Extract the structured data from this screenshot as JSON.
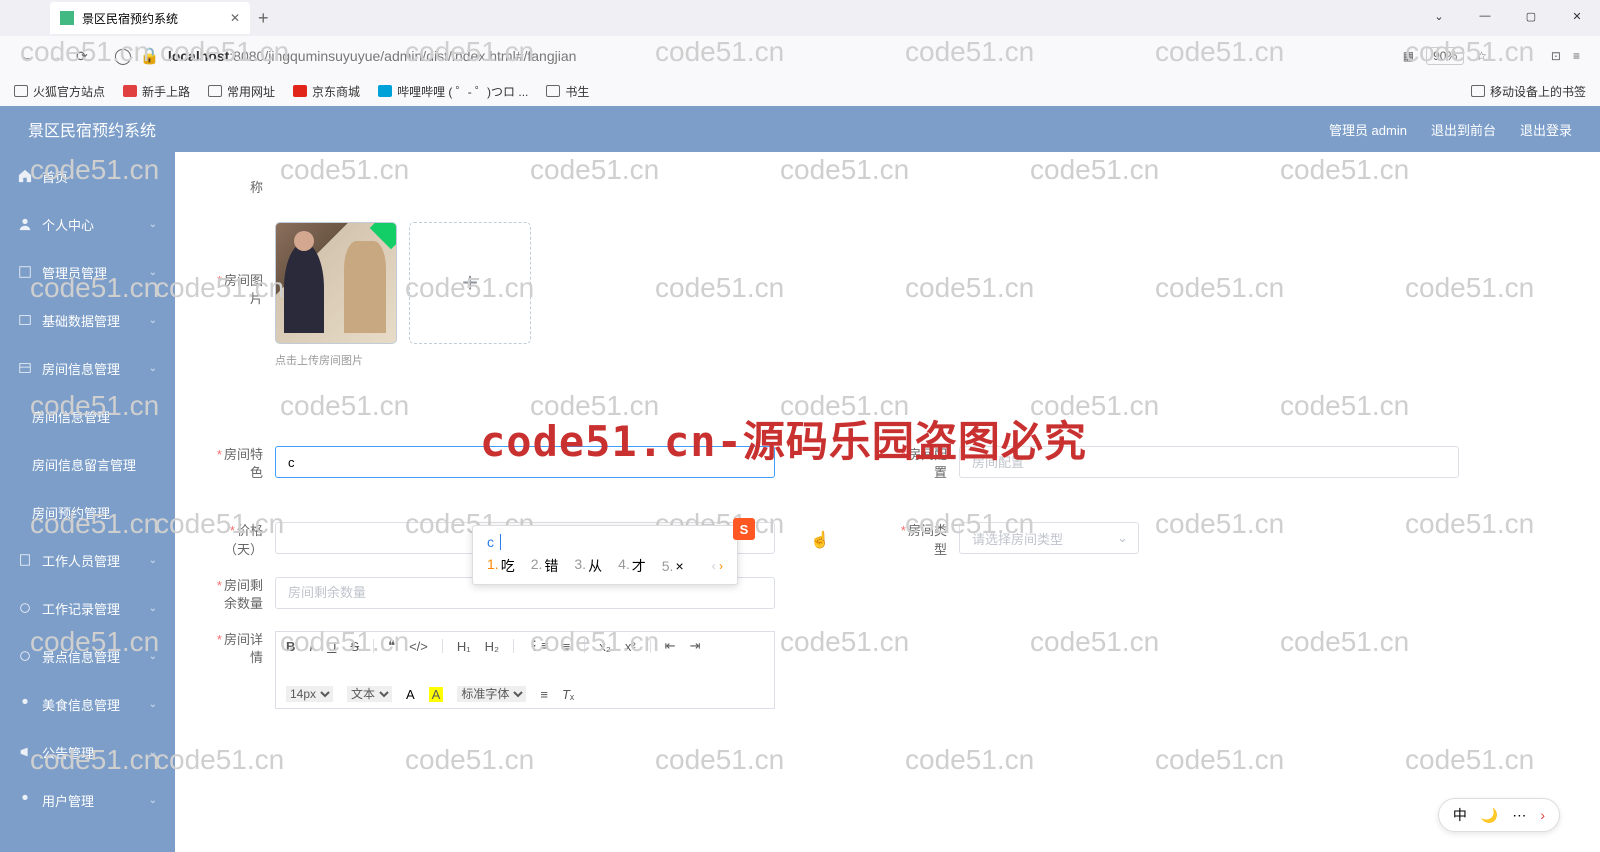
{
  "browser": {
    "tab_title": "景区民宿预约系统",
    "url_host": "localhost",
    "url_path": ":8080/jingquminsuyuyue/admin/dist/index.html#/fangjian",
    "zoom": "90%",
    "bookmarks": [
      "火狐官方站点",
      "新手上路",
      "常用网址",
      "京东商城",
      "哔哩哔哩 ( ゜- ゜)つロ ...",
      "书生"
    ],
    "bookmark_right": "移动设备上的书签"
  },
  "header": {
    "title": "景区民宿预约系统",
    "user": "管理员 admin",
    "logout_front": "退出到前台",
    "logout": "退出登录"
  },
  "sidebar": {
    "items": [
      {
        "label": "首页",
        "icon": "home"
      },
      {
        "label": "个人中心",
        "icon": "user",
        "expandable": true
      },
      {
        "label": "管理员管理",
        "icon": "admin",
        "expandable": true
      },
      {
        "label": "基础数据管理",
        "icon": "data",
        "expandable": true
      },
      {
        "label": "房间信息管理",
        "icon": "room",
        "expandable": true
      },
      {
        "label": "房间信息管理",
        "sub": true
      },
      {
        "label": "房间信息留言管理",
        "sub": true
      },
      {
        "label": "房间预约管理",
        "sub": true
      },
      {
        "label": "工作人员管理",
        "icon": "staff",
        "expandable": true
      },
      {
        "label": "工作记录管理",
        "icon": "log",
        "expandable": true
      },
      {
        "label": "景点信息管理",
        "icon": "scenic",
        "expandable": true
      },
      {
        "label": "美食信息管理",
        "icon": "food",
        "expandable": true
      },
      {
        "label": "公告管理",
        "icon": "notice",
        "expandable": true
      },
      {
        "label": "用户管理",
        "icon": "users",
        "expandable": true
      }
    ]
  },
  "form": {
    "label_name": "称",
    "label_image": "房间图片",
    "image_hint": "点击上传房间图片",
    "label_feature": "房间特色",
    "label_config": "房间配置",
    "config_placeholder": "房间配置",
    "label_price": "价格（天）",
    "label_type": "房间类型",
    "type_placeholder": "请选择房间类型",
    "label_remain": "房间剩余数量",
    "remain_placeholder": "房间剩余数量",
    "label_detail": "房间详情",
    "feature_value": "c"
  },
  "ime": {
    "input": "c",
    "candidates": [
      "吃",
      "错",
      "从",
      "才",
      "×"
    ]
  },
  "editor": {
    "font_size": "14px",
    "paragraph": "文本",
    "font": "标准字体"
  },
  "watermark": "code51.cn",
  "watermark_big": "code51.cn-源码乐园盗图必究",
  "lang_bar": {
    "lang": "中",
    "mode": "🌙"
  }
}
